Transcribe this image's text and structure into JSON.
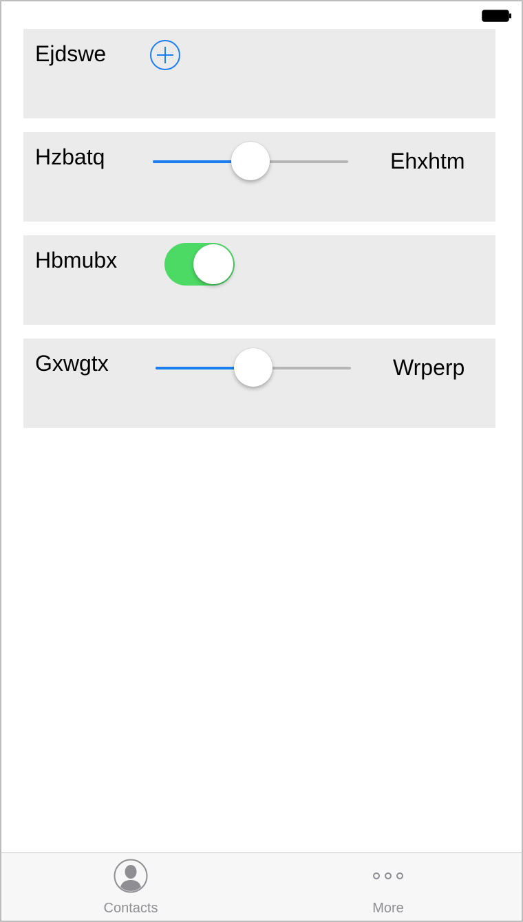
{
  "colors": {
    "accent": "#1a7ef0",
    "toggle_on": "#4cd964",
    "card_bg": "#ebebeb",
    "tab_inactive": "#8e8e93"
  },
  "status_bar": {
    "battery_icon": "battery-full-icon"
  },
  "cards": [
    {
      "label": "Ejdswe",
      "control": "add-button",
      "icon": "plus-circle-icon"
    },
    {
      "label": "Hzbatq",
      "control": "slider",
      "slider_value": 0.5,
      "max_label": "Ehxhtm"
    },
    {
      "label": "Hbmubx",
      "control": "toggle",
      "toggle_on": true
    },
    {
      "label": "Gxwgtx",
      "control": "slider",
      "slider_value": 0.5,
      "max_label": "Wrperp"
    }
  ],
  "tab_bar": {
    "tabs": [
      {
        "label": "Contacts",
        "icon": "person-circle-icon"
      },
      {
        "label": "More",
        "icon": "more-dots-icon"
      }
    ]
  }
}
